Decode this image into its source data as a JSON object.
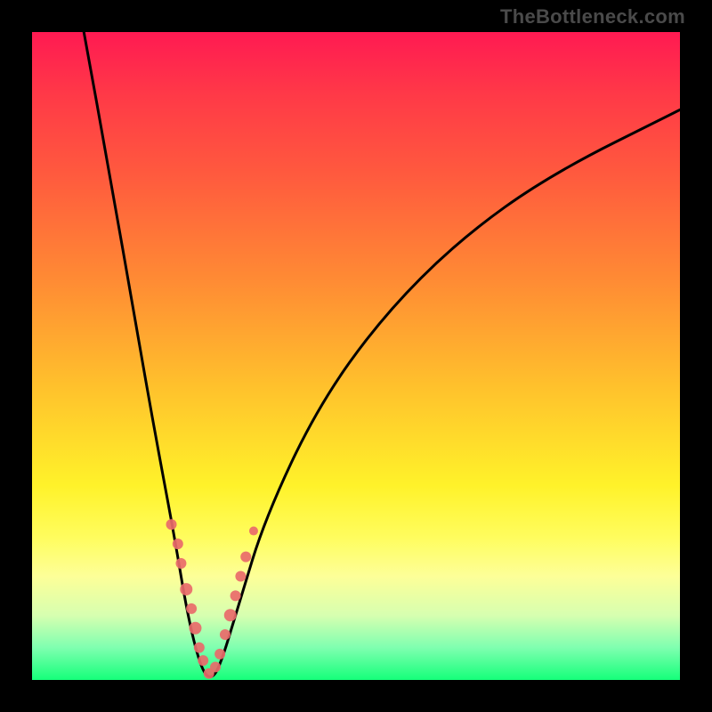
{
  "attribution": "TheBottleneck.com",
  "chart_data": {
    "type": "line",
    "title": "",
    "xlabel": "",
    "ylabel": "",
    "xlim": [
      0,
      100
    ],
    "ylim": [
      0,
      100
    ],
    "curve": {
      "name": "bottleneck-curve",
      "points": [
        {
          "x": 8,
          "y": 100
        },
        {
          "x": 12,
          "y": 78
        },
        {
          "x": 16,
          "y": 55
        },
        {
          "x": 19,
          "y": 38
        },
        {
          "x": 22,
          "y": 22
        },
        {
          "x": 24,
          "y": 10
        },
        {
          "x": 26,
          "y": 2
        },
        {
          "x": 27.5,
          "y": 0
        },
        {
          "x": 29,
          "y": 2
        },
        {
          "x": 32,
          "y": 12
        },
        {
          "x": 36,
          "y": 25
        },
        {
          "x": 44,
          "y": 42
        },
        {
          "x": 54,
          "y": 56
        },
        {
          "x": 66,
          "y": 68
        },
        {
          "x": 80,
          "y": 78
        },
        {
          "x": 100,
          "y": 88
        }
      ]
    },
    "scatter_clusters": [
      {
        "x": 21.5,
        "y": 24,
        "r": 6
      },
      {
        "x": 22.5,
        "y": 21,
        "r": 6
      },
      {
        "x": 23.0,
        "y": 18,
        "r": 6
      },
      {
        "x": 23.8,
        "y": 14,
        "r": 7
      },
      {
        "x": 24.6,
        "y": 11,
        "r": 6
      },
      {
        "x": 25.2,
        "y": 8,
        "r": 7
      },
      {
        "x": 25.8,
        "y": 5,
        "r": 6
      },
      {
        "x": 26.4,
        "y": 3,
        "r": 6
      },
      {
        "x": 27.3,
        "y": 1,
        "r": 6
      },
      {
        "x": 28.3,
        "y": 2,
        "r": 6
      },
      {
        "x": 29.0,
        "y": 4,
        "r": 6
      },
      {
        "x": 29.8,
        "y": 7,
        "r": 6
      },
      {
        "x": 30.6,
        "y": 10,
        "r": 7
      },
      {
        "x": 31.4,
        "y": 13,
        "r": 6
      },
      {
        "x": 32.2,
        "y": 16,
        "r": 6
      },
      {
        "x": 33.0,
        "y": 19,
        "r": 6
      },
      {
        "x": 34.2,
        "y": 23,
        "r": 5
      }
    ],
    "colors": {
      "curve": "#000000",
      "scatter": "#e96a6a",
      "gradient_top": "#ff1a52",
      "gradient_bottom": "#15ff7a"
    }
  }
}
